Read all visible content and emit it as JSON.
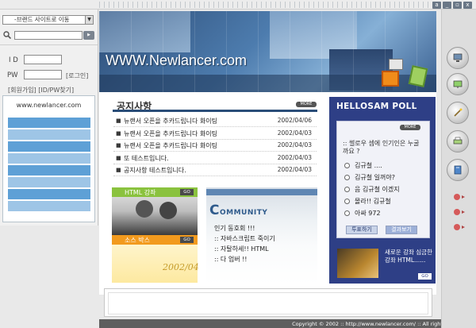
{
  "window": {
    "buttons": [
      "a",
      "_",
      "▫",
      "x"
    ]
  },
  "sidebar": {
    "site_select": "-브랜드 사이트로 이동",
    "search_placeholder": "",
    "id_label": "I D",
    "pw_label": "PW",
    "login_label": "[로그인]",
    "auth_links": "[회원가입] [ID/PW찾기]",
    "site_url": "www.newlancer.com",
    "menu_items": 8
  },
  "banner": {
    "title": "WWW.Newlancer.com"
  },
  "notice": {
    "title": "공지사항",
    "more_label": "MORE",
    "rows": [
      {
        "title": "뉴랜서 오픈을 추카드립니다 화이팅",
        "date": "2002/04/06"
      },
      {
        "title": "뉴랜서 오픈을 추카드립니다 화이팅",
        "date": "2002/04/03"
      },
      {
        "title": "뉴랜서 오픈을 추카드립니다 화이팅",
        "date": "2002/04/03"
      },
      {
        "title": "또 테스트입니다.",
        "date": "2002/04/03"
      },
      {
        "title": "공지사항 테스트입니다.",
        "date": "2002/04/03"
      }
    ]
  },
  "promos": {
    "html_course": {
      "name": "HTML 강좌",
      "go": "GO"
    },
    "source_box": {
      "name": "소스 박스",
      "go": "GO",
      "stamp": "2002/04"
    }
  },
  "community": {
    "title_initial": "C",
    "title_rest": "OMMUNITY",
    "lines": [
      "인기 동호회 !!!",
      ":: 자바스크립트 죽이기",
      ":: 자탈하세!! HTML",
      ":: 다 업버 !!"
    ]
  },
  "poll": {
    "title": "HELLOSAM POLL",
    "more_label": "MORE",
    "question": ":: 썰로우 셈에 인기인은 누굴 까요 ?",
    "options": [
      "김규철 ....",
      "김규철 일꺼야?",
      "음 김규철 이겠지",
      "몰라!! 김규철",
      "아싸 972"
    ],
    "vote_label": "투표하기",
    "result_label": "결과보기",
    "promo_text": "새로운 강좌 심금한 강좌 HTML......",
    "go": "GO"
  },
  "footer": {
    "copyright": "Copyright © 2002 :: http://www.newlancer.com/ :: All rights reserved."
  },
  "colors": {
    "accent": "#2e3f86",
    "banner": "#4d7cae",
    "menu": "#5ea0d6"
  },
  "toolbar": {
    "icons": [
      "pc-icon",
      "monitor-icon",
      "wand-icon",
      "printer-icon",
      "book-icon"
    ],
    "dots": 3
  }
}
